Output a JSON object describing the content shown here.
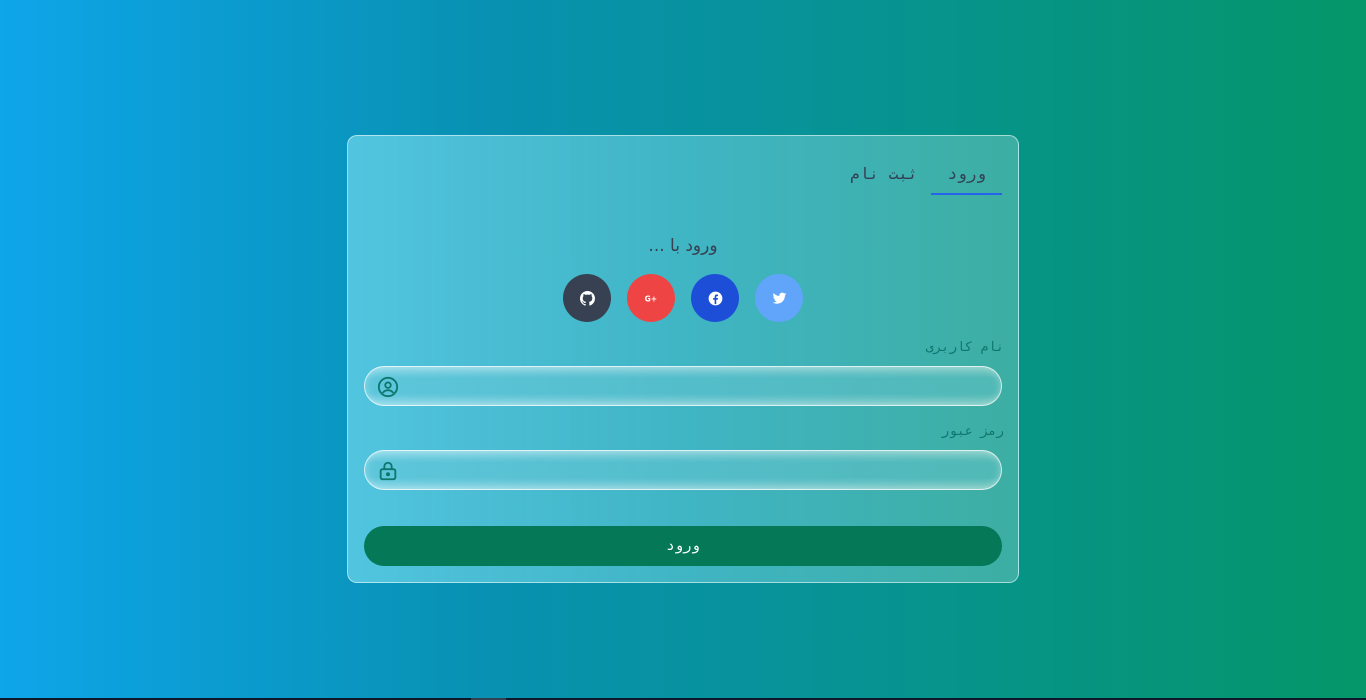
{
  "tabs": [
    {
      "label": "ورود",
      "active": true
    },
    {
      "label": "ثبت نام",
      "active": false
    }
  ],
  "login_with": "ورود با ...",
  "socials": [
    {
      "name": "github",
      "icon": "github-icon",
      "color": "#374151"
    },
    {
      "name": "google-plus",
      "icon": "google-plus-icon",
      "color": "#ef4444"
    },
    {
      "name": "facebook",
      "icon": "facebook-icon",
      "color": "#1d4ed8"
    },
    {
      "name": "twitter",
      "icon": "twitter-icon",
      "color": "#60a5fa"
    }
  ],
  "form": {
    "username_label": "نام کاربری",
    "username_value": "",
    "password_label": "رمز عبور",
    "password_value": "",
    "submit_label": "ورود"
  },
  "colors": {
    "accent": "#2563eb",
    "submit_bg": "#047857",
    "icon": "#0f766e"
  }
}
